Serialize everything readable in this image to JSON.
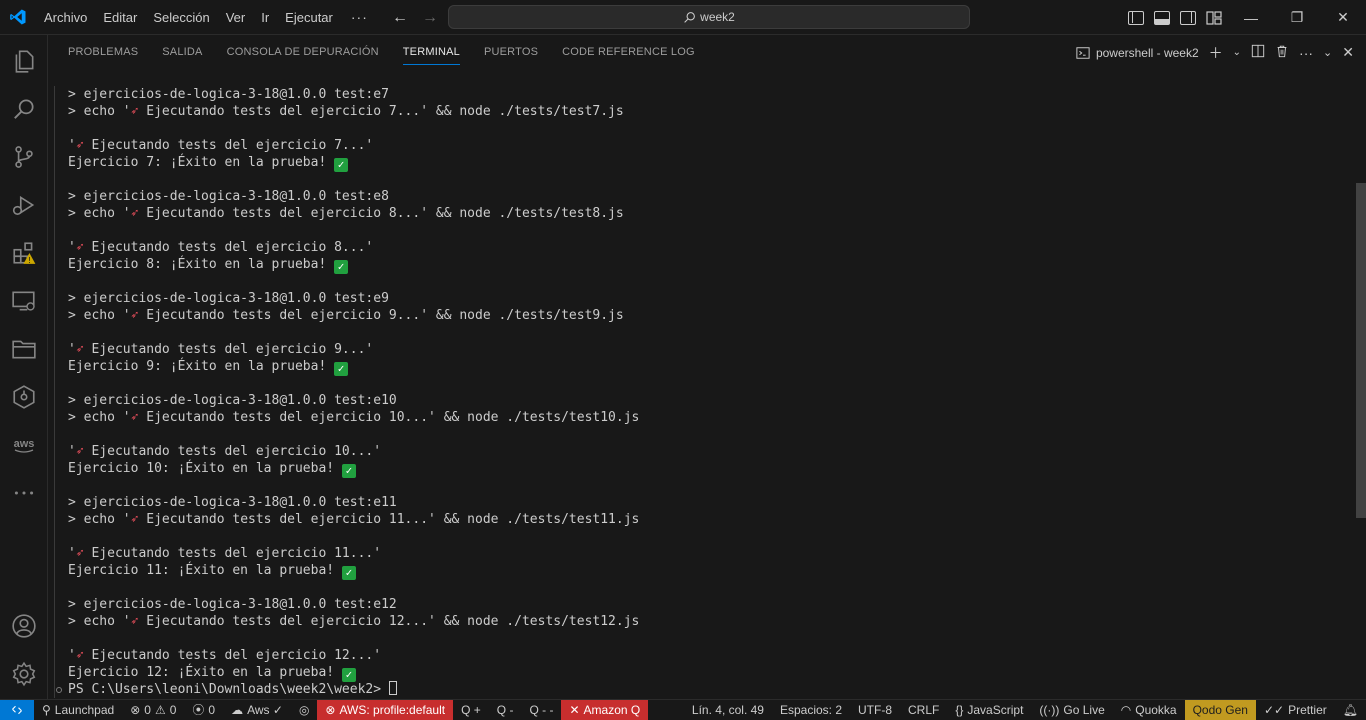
{
  "menu": {
    "items": [
      "Archivo",
      "Editar",
      "Selección",
      "Ver",
      "Ir",
      "Ejecutar"
    ],
    "more": "···"
  },
  "command_center": {
    "text": "week2",
    "icon": "search-icon"
  },
  "panel": {
    "tabs": [
      {
        "label": "PROBLEMAS",
        "active": false
      },
      {
        "label": "SALIDA",
        "active": false
      },
      {
        "label": "CONSOLA DE DEPURACIÓN",
        "active": false
      },
      {
        "label": "TERMINAL",
        "active": true
      },
      {
        "label": "PUERTOS",
        "active": false
      },
      {
        "label": "CODE REFERENCE LOG",
        "active": false
      }
    ],
    "terminal_name": "powershell - week2"
  },
  "terminal": {
    "lines": [
      {
        "type": "cmd",
        "text": "> ejercicios-de-logica-3-18@1.0.0 test:e7"
      },
      {
        "type": "echo",
        "pre": "> echo '",
        "post": " Ejecutando tests del ejercicio 7...' && node ./tests/test7.js"
      },
      {
        "type": "blank"
      },
      {
        "type": "rocket",
        "pre": "'",
        "post": " Ejecutando tests del ejercicio 7...'"
      },
      {
        "type": "result",
        "text": "Ejercicio 7: ¡Éxito en la prueba! "
      },
      {
        "type": "blank"
      },
      {
        "type": "cmd",
        "text": "> ejercicios-de-logica-3-18@1.0.0 test:e8"
      },
      {
        "type": "echo",
        "pre": "> echo '",
        "post": " Ejecutando tests del ejercicio 8...' && node ./tests/test8.js"
      },
      {
        "type": "blank"
      },
      {
        "type": "rocket",
        "pre": "'",
        "post": " Ejecutando tests del ejercicio 8...'"
      },
      {
        "type": "result",
        "text": "Ejercicio 8: ¡Éxito en la prueba! "
      },
      {
        "type": "blank"
      },
      {
        "type": "cmd",
        "text": "> ejercicios-de-logica-3-18@1.0.0 test:e9"
      },
      {
        "type": "echo",
        "pre": "> echo '",
        "post": " Ejecutando tests del ejercicio 9...' && node ./tests/test9.js"
      },
      {
        "type": "blank"
      },
      {
        "type": "rocket",
        "pre": "'",
        "post": " Ejecutando tests del ejercicio 9...'"
      },
      {
        "type": "result",
        "text": "Ejercicio 9: ¡Éxito en la prueba! "
      },
      {
        "type": "blank"
      },
      {
        "type": "cmd",
        "text": "> ejercicios-de-logica-3-18@1.0.0 test:e10"
      },
      {
        "type": "echo",
        "pre": "> echo '",
        "post": " Ejecutando tests del ejercicio 10...' && node ./tests/test10.js"
      },
      {
        "type": "blank"
      },
      {
        "type": "rocket",
        "pre": "'",
        "post": " Ejecutando tests del ejercicio 10...'"
      },
      {
        "type": "result",
        "text": "Ejercicio 10: ¡Éxito en la prueba! "
      },
      {
        "type": "blank"
      },
      {
        "type": "cmd",
        "text": "> ejercicios-de-logica-3-18@1.0.0 test:e11"
      },
      {
        "type": "echo",
        "pre": "> echo '",
        "post": " Ejecutando tests del ejercicio 11...' && node ./tests/test11.js"
      },
      {
        "type": "blank"
      },
      {
        "type": "rocket",
        "pre": "'",
        "post": " Ejecutando tests del ejercicio 11...'"
      },
      {
        "type": "result",
        "text": "Ejercicio 11: ¡Éxito en la prueba! "
      },
      {
        "type": "blank"
      },
      {
        "type": "cmd",
        "text": "> ejercicios-de-logica-3-18@1.0.0 test:e12"
      },
      {
        "type": "echo",
        "pre": "> echo '",
        "post": " Ejecutando tests del ejercicio 12...' && node ./tests/test12.js"
      },
      {
        "type": "blank"
      },
      {
        "type": "rocket",
        "pre": "'",
        "post": " Ejecutando tests del ejercicio 12...'"
      },
      {
        "type": "result",
        "text": "Ejercicio 12: ¡Éxito en la prueba! "
      },
      {
        "type": "prompt",
        "text": "PS C:\\Users\\leoni\\Downloads\\week2\\week2> "
      }
    ]
  },
  "statusbar": {
    "launchpad": "Launchpad",
    "errors": "0",
    "warnings": "0",
    "ports": "0",
    "aws": "Aws ✓",
    "aws_profile": "AWS: profile:default",
    "q_plus": "Q +",
    "q_minus": "Q -",
    "q_dash": "Q - -",
    "amazon_q": "Amazon Q",
    "position": "Lín. 4, col. 49",
    "spaces": "Espacios: 2",
    "encoding": "UTF-8",
    "eol": "CRLF",
    "language": "JavaScript",
    "golive": "Go Live",
    "quokka": "Quokka",
    "qodo": "Qodo Gen",
    "prettier": "Prettier"
  },
  "colors": {
    "accent": "#0078d4",
    "success_check": "#21a03f",
    "status_red": "#c72e2e",
    "status_qodo": "#c19a20"
  }
}
